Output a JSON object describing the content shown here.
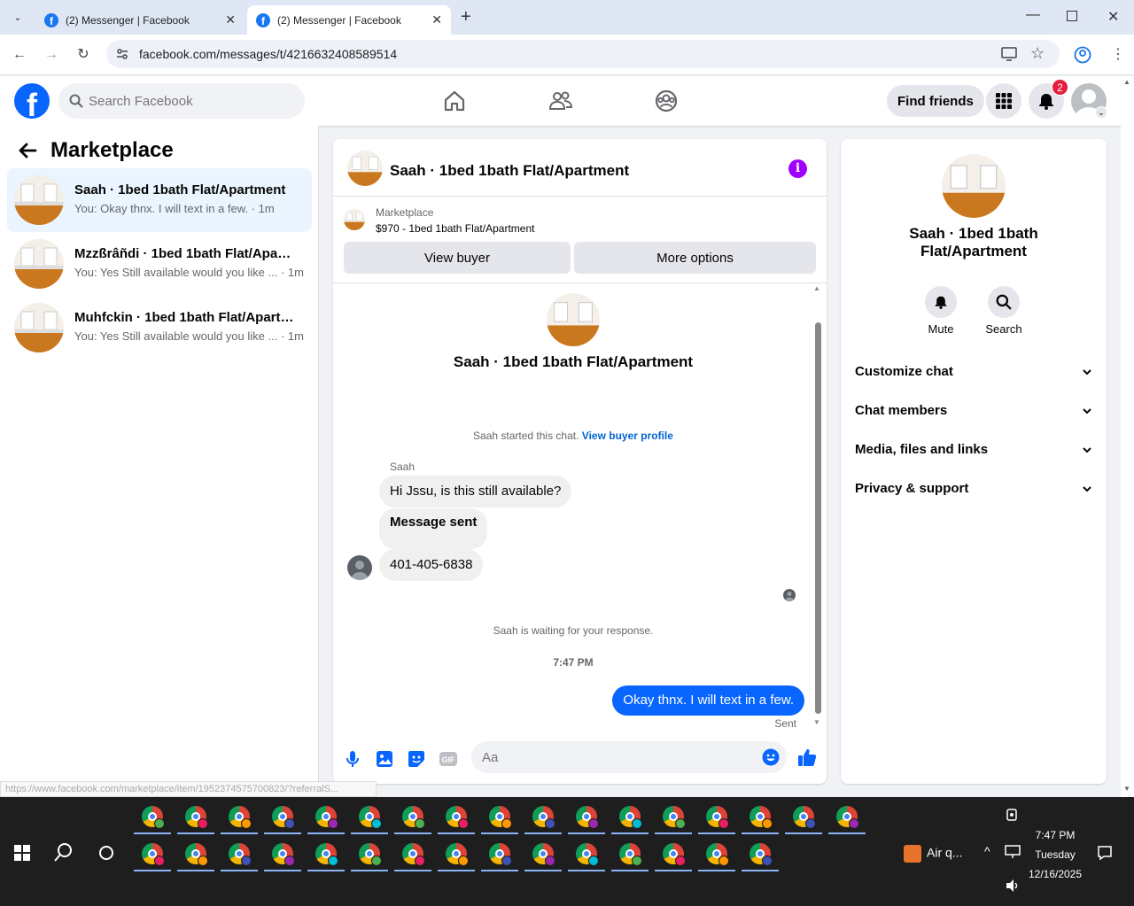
{
  "browser": {
    "tabs": [
      {
        "title": "(2) Messenger | Facebook",
        "active": false
      },
      {
        "title": "(2) Messenger | Facebook",
        "active": true
      }
    ],
    "url": "facebook.com/messages/t/4216632408589514",
    "status_url": "https://www.facebook.com/marketplace/item/1952374575700823/?referralS..."
  },
  "header": {
    "search_placeholder": "Search Facebook",
    "find_friends": "Find friends",
    "notification_count": "2"
  },
  "sidebar": {
    "title": "Marketplace",
    "conversations": [
      {
        "name": "Saah · 1bed 1bath Flat/Apartment",
        "preview": "You: Okay thnx. I will text in a few. · 1m",
        "active": true
      },
      {
        "name": "Mzzßrâñdi · 1bed 1bath Flat/Apart...",
        "preview": "You: Yes Still available would you like ... · 1m",
        "active": false
      },
      {
        "name": "Muhfckin · 1bed 1bath Flat/Apartm...",
        "preview": "You: Yes Still available would you like ... · 1m",
        "active": false
      }
    ]
  },
  "chat": {
    "title": "Saah · 1bed 1bath Flat/Apartment",
    "marketplace_label": "Marketplace",
    "listing": "$970 - 1bed 1bath Flat/Apartment",
    "view_buyer": "View buyer",
    "more_options": "More options",
    "started_text": "Saah started this chat.",
    "view_buyer_profile": "View buyer profile",
    "sender": "Saah",
    "messages_in": [
      "Hi Jssu, is this still available?",
      "Message sent",
      "401-405-6838"
    ],
    "waiting": "Saah is waiting for your response.",
    "time": "7:47 PM",
    "message_out": "Okay thnx. I will text in a few.",
    "sent": "Sent",
    "composer_placeholder": "Aa"
  },
  "right_panel": {
    "name": "Saah · 1bed 1bath Flat/Apartment",
    "mute": "Mute",
    "search": "Search",
    "sections": [
      "Customize chat",
      "Chat members",
      "Media, files and links",
      "Privacy & support"
    ]
  },
  "taskbar": {
    "weather": "Air q...",
    "time": "7:47 PM",
    "day": "Tuesday",
    "date": "12/16/2025"
  },
  "colors": {
    "fb_blue": "#0866ff",
    "accent_purple": "#a100ff",
    "badge_red": "#e41e3f"
  }
}
